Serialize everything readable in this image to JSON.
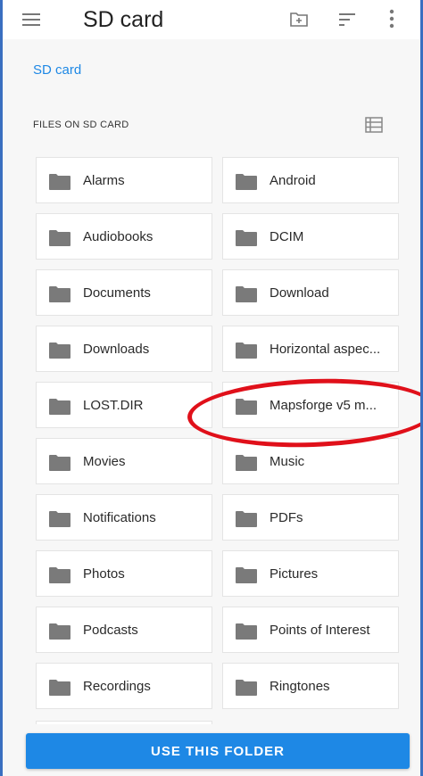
{
  "appbar": {
    "title": "SD card"
  },
  "breadcrumb": {
    "current": "SD card"
  },
  "section": {
    "heading": "FILES ON SD CARD"
  },
  "folders": [
    "Alarms",
    "Android",
    "Audiobooks",
    "DCIM",
    "Documents",
    "Download",
    "Downloads",
    "Horizontal aspec...",
    "LOST.DIR",
    "Mapsforge v5 m...",
    "Movies",
    "Music",
    "Notifications",
    "PDFs",
    "Photos",
    "Pictures",
    "Podcasts",
    "Points of Interest",
    "Recordings",
    "Ringtones"
  ],
  "action": {
    "use_folder_label": "USE THIS FOLDER"
  },
  "colors": {
    "accent": "#1e88e5",
    "annotation": "#e0101a",
    "frame": "#3a6fc0",
    "folder_icon": "#7a7a7a"
  },
  "icons": {
    "menu": "hamburger-menu-icon",
    "new_folder": "new-folder-icon",
    "sort": "sort-icon",
    "more": "more-vert-icon",
    "list_view": "list-view-icon",
    "folder": "folder-icon"
  }
}
